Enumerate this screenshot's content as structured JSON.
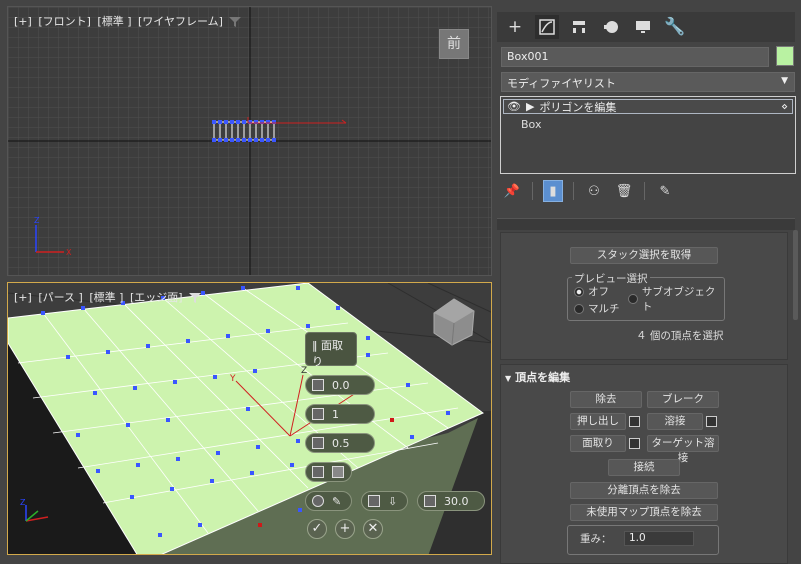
{
  "front_viewport": {
    "label_plus": "[+]",
    "label_view": "[フロント]",
    "label_shading": "[標準 ]",
    "label_mode": "[ワイヤフレーム]",
    "badge": "前"
  },
  "persp_viewport": {
    "label_plus": "[+]",
    "label_view": "[パース ]",
    "label_shading": "[標準 ]",
    "label_mode": "[エッジ面]",
    "caddy": {
      "title": "面取り",
      "height": "0.0",
      "segments": "1",
      "amount": "0.5",
      "angle": "30.0"
    }
  },
  "panel": {
    "object_name": "Box001",
    "color": "#b9f2a2",
    "modifier_list": "モディファイヤリスト",
    "stack": {
      "item_top": "ポリゴンを編集",
      "item_base": "Box"
    },
    "selection": {
      "get_stack_selection": "スタック選択を取得",
      "preview_group": "プレビュー選択",
      "opt_off": "オフ",
      "opt_subobject": "サブオブジェクト",
      "opt_multi": "マルチ",
      "status": "４ 個の頂点を選択"
    },
    "edit_vertices": {
      "header": "頂点を編集",
      "remove": "除去",
      "break": "ブレーク",
      "extrude": "押し出し",
      "weld": "溶接",
      "chamfer": "面取り",
      "target_weld": "ターゲット溶接",
      "connect": "接続",
      "remove_isolated": "分離頂点を除去",
      "remove_unused_map": "未使用マップ頂点を除去",
      "weight_label": "重み：",
      "weight_value": "1.0"
    }
  }
}
